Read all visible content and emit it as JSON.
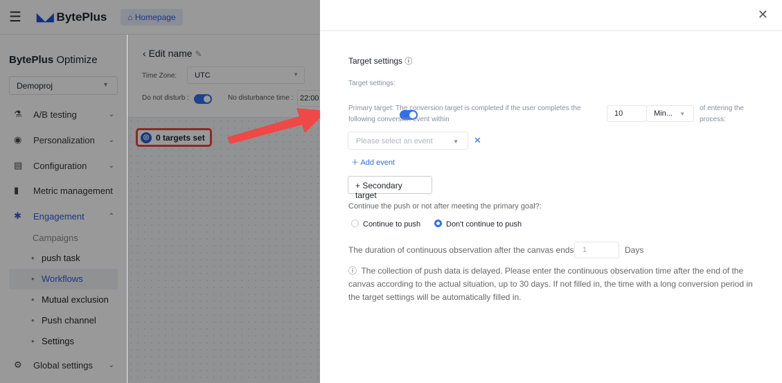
{
  "topbar": {
    "brand": "BytePlus",
    "home": "Homepage"
  },
  "sidebar": {
    "brand_bold": "BytePlus",
    "brand_rest": " Optimize",
    "project": "Demoproj",
    "items": [
      {
        "label": "A/B testing"
      },
      {
        "label": "Personalization"
      },
      {
        "label": "Configuration"
      },
      {
        "label": "Metric management"
      },
      {
        "label": "Engagement"
      },
      {
        "label": "Global settings"
      }
    ],
    "group": "Campaigns",
    "sub": [
      {
        "label": "push task"
      },
      {
        "label": "Workflows"
      },
      {
        "label": "Mutual exclusion"
      },
      {
        "label": "Push channel"
      },
      {
        "label": "Settings"
      }
    ]
  },
  "main": {
    "title": "Edit name",
    "timezone_label": "Time Zone:",
    "timezone": "UTC",
    "dnd_label": "Do not disturb :",
    "dnd_time_label": "No disturbance time :",
    "dnd_time": "22:00",
    "targets": "0 targets set"
  },
  "drawer": {
    "title": "Target settings",
    "toggle_label": "Target settings:",
    "primary": "Primary target: The conversion target is completed if the user completes the following conversion event within",
    "amount": "10",
    "unit": "Min...",
    "after": "of entering the process:",
    "event_placeholder": "Please select an event",
    "add_event": "Add event",
    "secondary": "+ Secondary target",
    "continue_q": "Continue the push or not after meeting the primary goal?:",
    "opt1": "Continue to push",
    "opt2": "Don't continue to push",
    "duration_label": "The duration of continuous observation after the canvas ends:",
    "duration_placeholder": "1",
    "days": "Days",
    "note": "The collection of push data is delayed. Please enter the continuous observation time after the end of the canvas according to the actual situation, up to 30 days. If not filled in, the time with a long conversion period in the target settings will be automatically filled in."
  },
  "colors": {
    "accent": "#2f6fed",
    "highlight": "#f04040"
  }
}
